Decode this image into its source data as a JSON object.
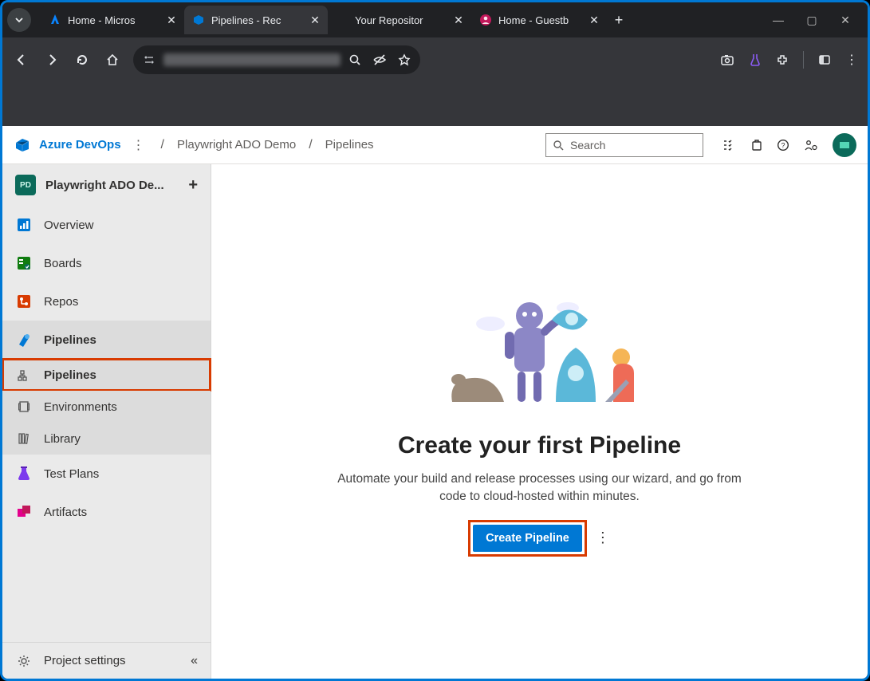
{
  "browser": {
    "tabs": [
      {
        "title": "Home - Micros",
        "active": false,
        "favicon": "azure-a"
      },
      {
        "title": "Pipelines - Rec",
        "active": true,
        "favicon": "ado"
      },
      {
        "title": "Your Repositor",
        "active": false,
        "favicon": "none"
      },
      {
        "title": "Home - Guestb",
        "active": false,
        "favicon": "avatar"
      }
    ],
    "omnibox_placeholder": "dev.azure.com/playwright-ado-demo/..."
  },
  "header": {
    "brand": "Azure DevOps",
    "breadcrumbs": [
      "Playwright ADO Demo",
      "Pipelines"
    ],
    "search_placeholder": "Search"
  },
  "sidebar": {
    "project_badge": "PD",
    "project_name": "Playwright ADO De...",
    "items": [
      {
        "label": "Overview",
        "icon": "overview",
        "color": "#0078d4"
      },
      {
        "label": "Boards",
        "icon": "boards",
        "color": "#107c10"
      },
      {
        "label": "Repos",
        "icon": "repos",
        "color": "#d83b01"
      },
      {
        "label": "Pipelines",
        "icon": "pipelines",
        "color": "#0078d4",
        "active": true,
        "children": [
          {
            "label": "Pipelines",
            "selected": true,
            "highlighted": true
          },
          {
            "label": "Environments"
          },
          {
            "label": "Library"
          }
        ]
      },
      {
        "label": "Test Plans",
        "icon": "testplans",
        "color": "#7c3aed"
      },
      {
        "label": "Artifacts",
        "icon": "artifacts",
        "color": "#e3008c"
      }
    ],
    "footer_label": "Project settings"
  },
  "main": {
    "headline": "Create your first Pipeline",
    "subtext": "Automate your build and release processes using our wizard, and go from code to cloud-hosted within minutes.",
    "primary_button": "Create Pipeline"
  }
}
